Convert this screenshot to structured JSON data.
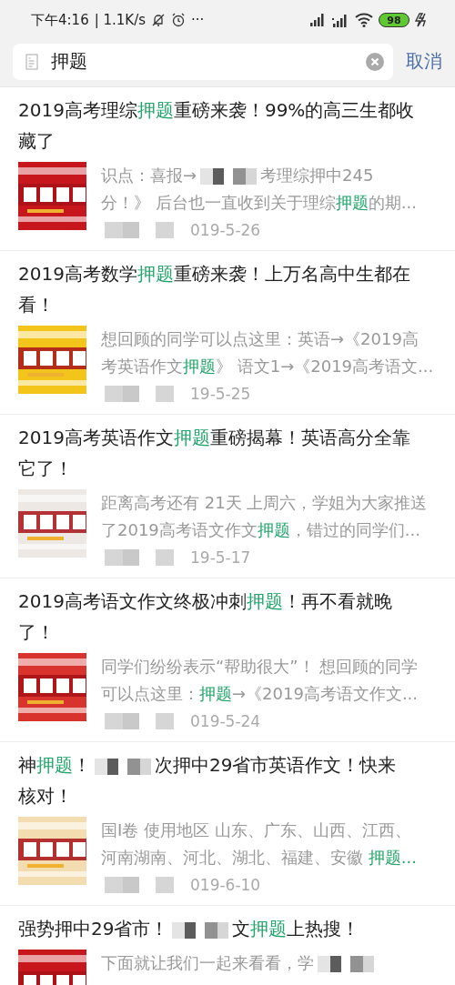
{
  "status_bar": {
    "time": "下午4:16",
    "speed": "| 1.1K/s",
    "more": "···",
    "battery": "98"
  },
  "search": {
    "value": "押题",
    "cancel": "取消"
  },
  "results": [
    {
      "title": [
        [
          {
            "kind": "text",
            "text": "2019高考理综"
          },
          {
            "kind": "match",
            "text": "押题"
          },
          {
            "kind": "text",
            "text": "重磅来袭！99%的高三生都收"
          }
        ],
        [
          {
            "kind": "text",
            "text": "藏了"
          }
        ]
      ],
      "snippet": [
        [
          {
            "kind": "text",
            "text": "识点：喜报→"
          },
          {
            "kind": "blur"
          },
          {
            "kind": "text",
            "text": "考理综押中245"
          }
        ],
        [
          {
            "kind": "text",
            "text": "分！》 后台也一直收到关于理综"
          },
          {
            "kind": "match",
            "text": "押题"
          },
          {
            "kind": "text",
            "text": "的期..."
          }
        ]
      ],
      "date": "019-5-26"
    },
    {
      "title": [
        [
          {
            "kind": "text",
            "text": "2019高考数学"
          },
          {
            "kind": "match",
            "text": "押题"
          },
          {
            "kind": "text",
            "text": "重磅来袭！上万名高中生都在"
          }
        ],
        [
          {
            "kind": "text",
            "text": "看！"
          }
        ]
      ],
      "snippet": [
        [
          {
            "kind": "text",
            "text": "想回顾的同学可以点这里：英语→《2019高"
          }
        ],
        [
          {
            "kind": "text",
            "text": "考英语作文"
          },
          {
            "kind": "match",
            "text": "押题"
          },
          {
            "kind": "text",
            "text": "》 语文1→《2019高考语文..."
          }
        ]
      ],
      "date": "19-5-25"
    },
    {
      "title": [
        [
          {
            "kind": "text",
            "text": "2019高考英语作文"
          },
          {
            "kind": "match",
            "text": "押题"
          },
          {
            "kind": "text",
            "text": "重磅揭幕！英语高分全靠"
          }
        ],
        [
          {
            "kind": "text",
            "text": "它了！"
          }
        ]
      ],
      "snippet": [
        [
          {
            "kind": "text",
            "text": "距离高考还有 21天 上周六，学姐为大家推送"
          }
        ],
        [
          {
            "kind": "text",
            "text": "了2019高考语文作文"
          },
          {
            "kind": "match",
            "text": "押题"
          },
          {
            "kind": "text",
            "text": "，错过的同学们..."
          }
        ]
      ],
      "date": "19-5-17"
    },
    {
      "title": [
        [
          {
            "kind": "text",
            "text": "2019高考语文作文终极冲刺"
          },
          {
            "kind": "match",
            "text": "押题"
          },
          {
            "kind": "text",
            "text": "！再不看就晚"
          }
        ],
        [
          {
            "kind": "text",
            "text": "了！"
          }
        ]
      ],
      "snippet": [
        [
          {
            "kind": "text",
            "text": "同学们纷纷表示“帮助很大”！ 想回顾的同学"
          }
        ],
        [
          {
            "kind": "text",
            "text": "可以点这里："
          },
          {
            "kind": "match",
            "text": "押题"
          },
          {
            "kind": "text",
            "text": "→《2019高考语文作文..."
          }
        ]
      ],
      "date": "019-5-24"
    },
    {
      "title": [
        [
          {
            "kind": "text",
            "text": "神"
          },
          {
            "kind": "match",
            "text": "押题"
          },
          {
            "kind": "text",
            "text": "！"
          },
          {
            "kind": "blur"
          },
          {
            "kind": "text",
            "text": "次押中29省市英语作文！快来"
          }
        ],
        [
          {
            "kind": "text",
            "text": "核对！"
          }
        ]
      ],
      "snippet": [
        [
          {
            "kind": "text",
            "text": "国I卷 使用地区 山东、广东、山西、江西、"
          }
        ],
        [
          {
            "kind": "text",
            "text": "河南湖南、河北、湖北、福建、安徽 "
          },
          {
            "kind": "match",
            "text": "押题..."
          }
        ]
      ],
      "date": "019-6-10"
    },
    {
      "title": [
        [
          {
            "kind": "text",
            "text": "强势押中29省市！"
          },
          {
            "kind": "blur"
          },
          {
            "kind": "text",
            "text": "文"
          },
          {
            "kind": "match",
            "text": "押题"
          },
          {
            "kind": "text",
            "text": "上热搜！"
          }
        ]
      ],
      "snippet": [
        [
          {
            "kind": "text",
            "text": "下面就让我们一起来看看，学"
          },
          {
            "kind": "blur"
          }
        ]
      ]
    }
  ]
}
